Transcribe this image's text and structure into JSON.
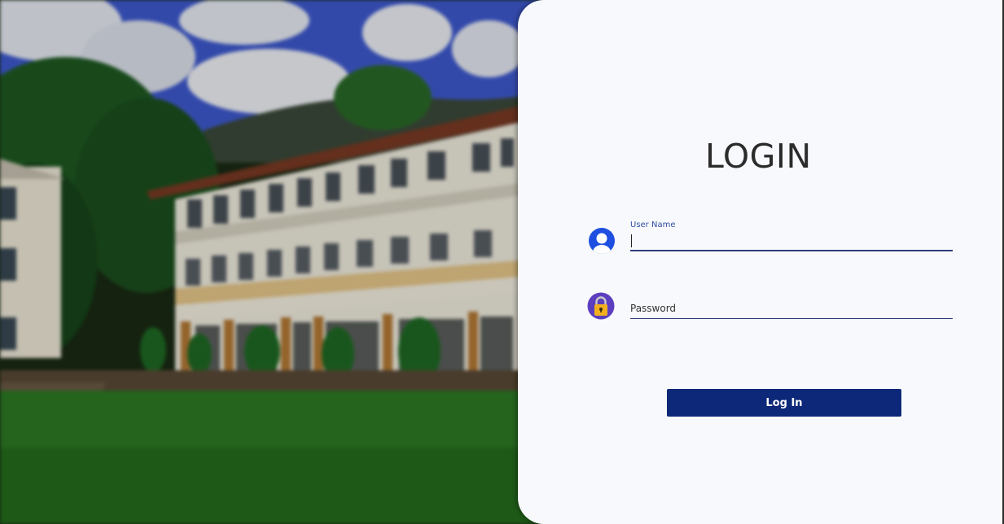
{
  "login": {
    "title": "LOGIN",
    "username": {
      "label": "User Name",
      "value": ""
    },
    "password": {
      "placeholder": "Password",
      "value": ""
    },
    "submit_label": "Log In"
  },
  "icons": {
    "username": "user-icon",
    "password": "lock-icon"
  },
  "colors": {
    "card_background": "#f8f9fc",
    "button": "#0d2878",
    "input_underline": "#2e3f7d",
    "user_icon": "#1f4fe0",
    "lock_icon_circle": "#5b3fbf",
    "lock_icon_body": "#f2b01e"
  }
}
